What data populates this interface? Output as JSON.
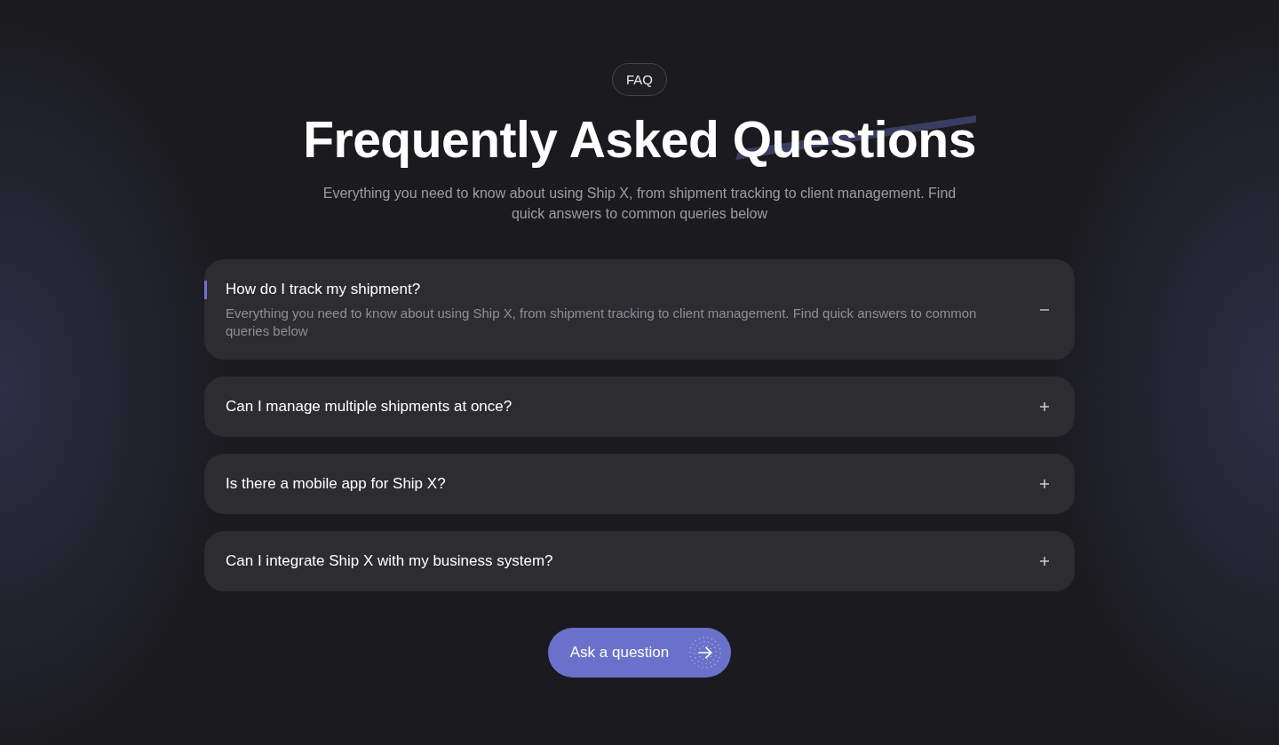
{
  "section": {
    "badge": "FAQ",
    "title": "Frequently Asked Questions",
    "subtitle": "Everything you need to know about using Ship X, from shipment tracking to client management. Find quick answers to common queries below"
  },
  "items": [
    {
      "question": "How do I track my shipment?",
      "answer": "Everything you need to know about using Ship X, from shipment tracking to client management. Find quick answers to common queries below",
      "expanded": true
    },
    {
      "question": "Can I manage multiple shipments at once?",
      "expanded": false
    },
    {
      "question": "Is there a mobile app for Ship X?",
      "expanded": false
    },
    {
      "question": "Can I integrate Ship X with my business system?",
      "expanded": false
    }
  ],
  "cta": {
    "label": "Ask a question"
  }
}
